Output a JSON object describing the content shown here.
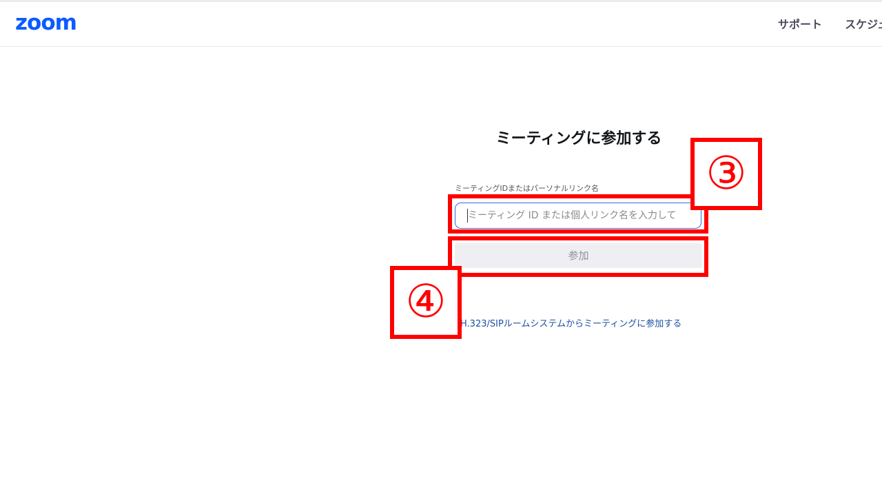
{
  "header": {
    "logo": "zoom",
    "nav": [
      {
        "label": "サポート"
      },
      {
        "label": "スケジュ"
      }
    ]
  },
  "main": {
    "title": "ミーティングに参加する",
    "field_label": "ミーティングIDまたはパーソナルリンク名",
    "input_placeholder": "ミーティング ID または個人リンク名を入力して",
    "input_value": "",
    "join_label": "参加",
    "sip_link": "H.323/SIPルームシステムからミーティングに参加する"
  },
  "annotations": {
    "badge_3": "③",
    "badge_4": "④",
    "color": "#ff0000"
  },
  "colors": {
    "brand": "#0b5cff",
    "input_border": "#2d6cdf",
    "button_bg": "#efeff3",
    "link": "#1c4fa3"
  }
}
